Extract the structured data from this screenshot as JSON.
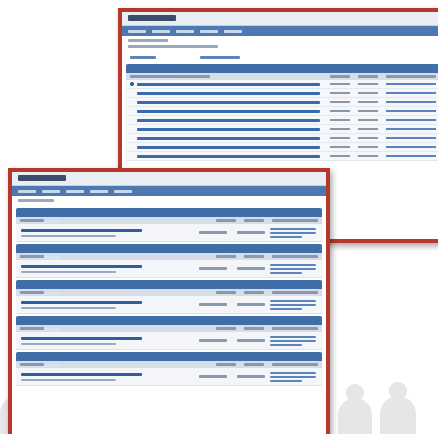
{
  "colors": {
    "frame_border": "#b5382a",
    "nav_bar": "#4d79b0",
    "category_bar": "#3f6ea8",
    "link": "#2d5fa0",
    "header_bg": "#e9eef5"
  },
  "icons": {
    "people": "person-silhouette-icon",
    "topic": "topic-bullet-icon"
  },
  "front": {
    "categories": [
      {
        "rows": 1
      },
      {
        "rows": 1
      },
      {
        "rows": 1
      },
      {
        "rows": 1
      },
      {
        "rows": 1
      }
    ]
  },
  "back": {
    "list_rows": 9
  }
}
